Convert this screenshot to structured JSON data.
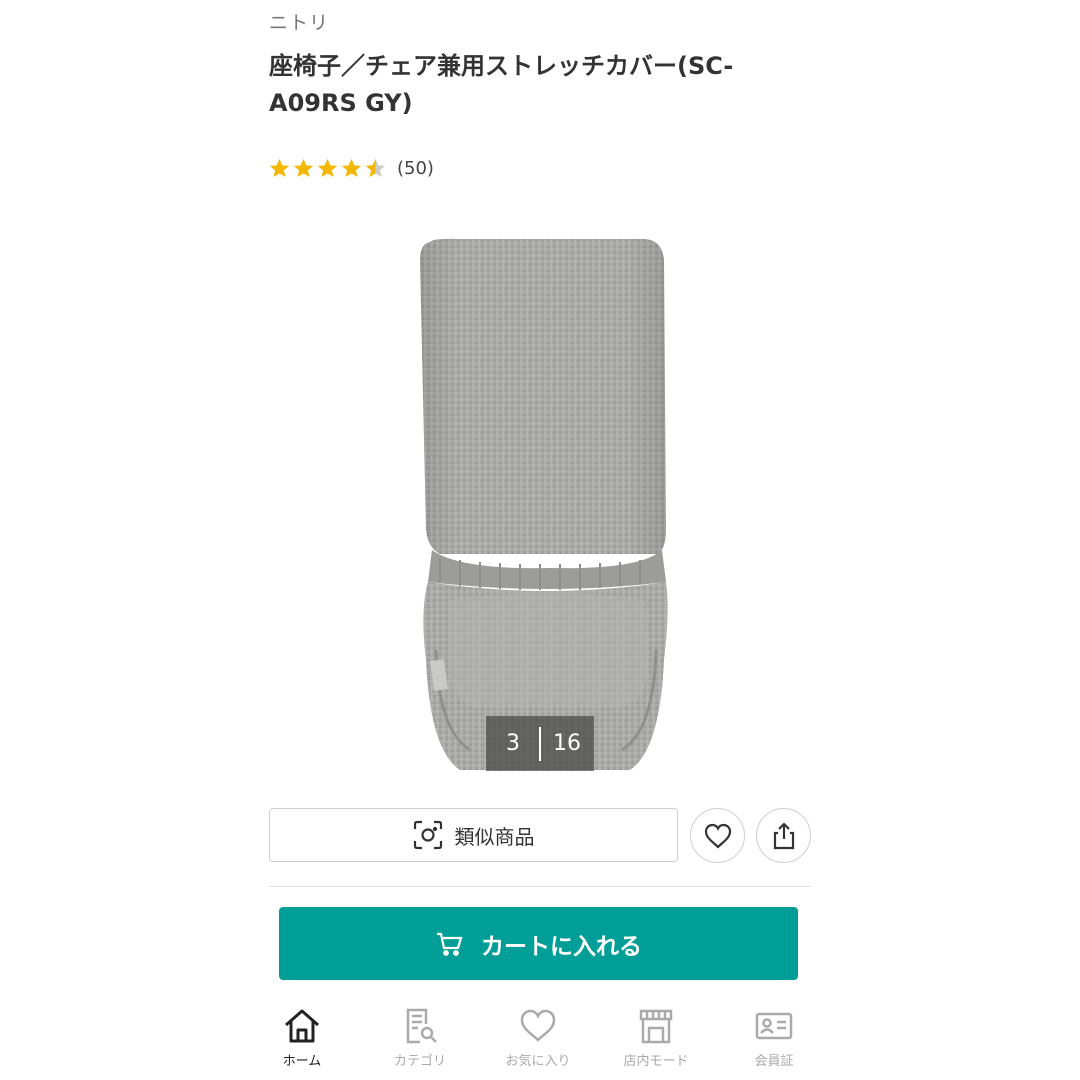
{
  "product": {
    "brand": "ニトリ",
    "title": "座椅子／チェア兼用ストレッチカバー(SC-A09RS GY)",
    "rating": 4.5,
    "review_count": "(50)"
  },
  "gallery": {
    "current": "3",
    "total": "16"
  },
  "actions": {
    "similar_label": "類似商品",
    "similar_icon": "camera-scan-icon",
    "favorite_icon": "heart-icon",
    "share_icon": "share-icon",
    "cart_label": "カートに入れる",
    "cart_icon": "cart-icon"
  },
  "nav": {
    "items": [
      {
        "label": "ホーム",
        "icon": "home-icon",
        "active": true
      },
      {
        "label": "カテゴリ",
        "icon": "category-search-icon",
        "active": false
      },
      {
        "label": "お気に入り",
        "icon": "heart-icon",
        "active": false
      },
      {
        "label": "店内モード",
        "icon": "store-icon",
        "active": false
      },
      {
        "label": "会員証",
        "icon": "member-card-icon",
        "active": false
      }
    ]
  },
  "colors": {
    "accent": "#009e96",
    "star": "#f5b800",
    "star_empty": "#cccccc"
  }
}
